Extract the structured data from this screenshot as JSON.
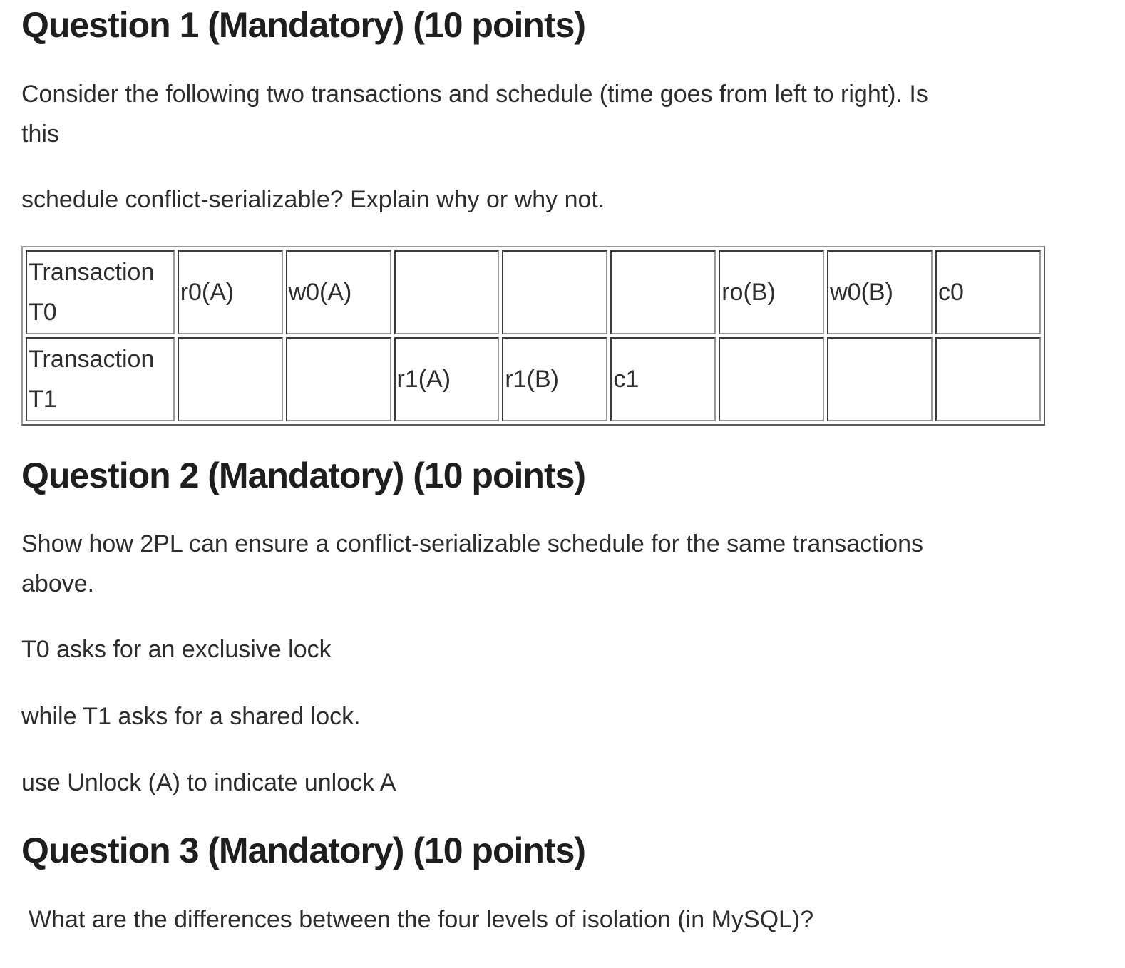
{
  "questions": [
    {
      "title": "Question 1 (Mandatory) (10 points)",
      "paragraphs": [
        "Consider the following two transactions and schedule (time goes from left to right). Is this",
        "schedule conflict-serializable? Explain why or why not."
      ],
      "paragraph_lines": [
        "Consider the following two transactions and schedule (time goes from left to right). Is",
        "this"
      ],
      "schedule_table": {
        "rows": [
          {
            "label": "Transaction T0",
            "cells": [
              "r0(A)",
              "w0(A)",
              "",
              "",
              "",
              "ro(B)",
              "w0(B)",
              "c0"
            ]
          },
          {
            "label": "Transaction T1",
            "cells": [
              "",
              "",
              "r1(A)",
              "r1(B)",
              "c1",
              "",
              "",
              ""
            ]
          }
        ]
      }
    },
    {
      "title": "Question 2 (Mandatory) (10 points)",
      "paragraphs": [
        "Show how 2PL can ensure a conflict-serializable schedule for the same transactions above.",
        "T0 asks for an exclusive lock",
        "while T1 asks for a shared lock.",
        "use Unlock (A) to indicate unlock A"
      ],
      "paragraph_lines": [
        "Show how 2PL can ensure a conflict-serializable schedule for the same transactions",
        "above."
      ]
    },
    {
      "title": "Question 3 (Mandatory) (10 points)",
      "paragraphs": [
        "What are the differences between the four levels of isolation (in MySQL)?"
      ]
    }
  ]
}
